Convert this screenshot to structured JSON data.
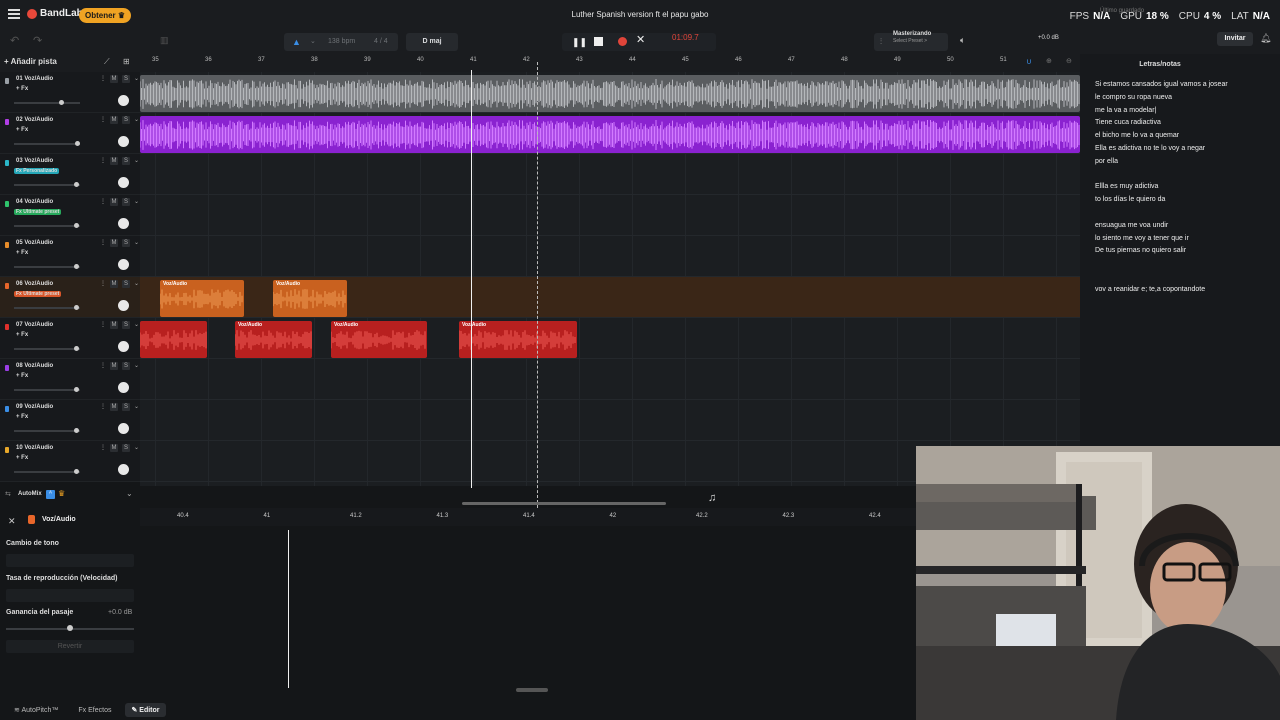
{
  "app": {
    "logo": "BandLab",
    "get_pro": "Obtener ♛",
    "project_title": "Luther Spanish version ft el papu gabo",
    "saved_note": "Último guardado"
  },
  "stats": [
    {
      "label": "FPS",
      "value": "N/A"
    },
    {
      "label": "GPU",
      "value": "18 %"
    },
    {
      "label": "CPU",
      "value": "4 %"
    },
    {
      "label": "LAT",
      "value": "N/A"
    }
  ],
  "transport": {
    "bpm": "138 bpm",
    "signature": "4 / 4",
    "key": "D maj",
    "time": "01:09.7",
    "master_label": "Masterizando",
    "master_sub": "Select Preset >",
    "volume_db": "+0.0 dB",
    "volume_level": 0.76,
    "invite": "Invitar"
  },
  "tracks_header": {
    "add_track": "+ Añadir pista"
  },
  "tracks": [
    {
      "name": "01 Voz/Audio",
      "fx": "+ Fx",
      "color": "#9aa0a6",
      "fx_color": "",
      "vol": 0.72
    },
    {
      "name": "02 Voz/Audio",
      "fx": "+ Fx",
      "color": "#b13ee6",
      "fx_color": "",
      "vol": 0.98
    },
    {
      "name": "03 Voz/Audio",
      "fx": "Fx Personalizado",
      "color": "#2bb7c9",
      "fx_color": "#25a7b8",
      "vol": 0.96
    },
    {
      "name": "04 Voz/Audio",
      "fx": "Fx Ultimate preset",
      "color": "#2fc46c",
      "fx_color": "#27a95c",
      "vol": 0.96
    },
    {
      "name": "05 Voz/Audio",
      "fx": "+ Fx",
      "color": "#e88d2a",
      "fx_color": "",
      "vol": 0.96
    },
    {
      "name": "06 Voz/Audio",
      "fx": "Fx Ultimate preset",
      "color": "#e8662a",
      "fx_color": "#d8562a",
      "vol": 0.96
    },
    {
      "name": "07 Voz/Audio",
      "fx": "+ Fx",
      "color": "#e0302c",
      "fx_color": "",
      "vol": 0.96
    },
    {
      "name": "08 Voz/Audio",
      "fx": "+ Fx",
      "color": "#9b3ee6",
      "fx_color": "",
      "vol": 0.96
    },
    {
      "name": "09 Voz/Audio",
      "fx": "+ Fx",
      "color": "#3a8ee6",
      "fx_color": "",
      "vol": 0.96
    },
    {
      "name": "10 Voz/Audio",
      "fx": "+ Fx",
      "color": "#e8a82a",
      "fx_color": "",
      "vol": 0.96
    }
  ],
  "automix": {
    "label": "AutoMix"
  },
  "ruler_bars": [
    "35",
    "36",
    "37",
    "38",
    "39",
    "40",
    "41",
    "42",
    "43",
    "44",
    "45",
    "46",
    "47",
    "48",
    "49",
    "50",
    "51"
  ],
  "clip_label": "Voz/Audio",
  "lyrics": {
    "title": "Letras/notas",
    "lines": [
      "Si estamos cansados igual vamos a josear",
      "le compro su ropa nueva",
      "me la va a modelar|",
      "Tiene cuca radiactiva",
      "el bicho me lo va a quemar",
      "Ella es adictiva no te lo voy a negar",
      "por ella",
      "",
      "Ellla es muy adictiva",
      "to los días le quiero da",
      "",
      "ensuagua me voa undir",
      "lo siento me voy a tener que ir",
      "De tus piernas no quiero salir",
      "",
      "",
      "vov a reanidar e; te,a copontandote"
    ]
  },
  "editor": {
    "track_name": "Voz/Audio",
    "ticks": [
      "40.4",
      "41",
      "41.2",
      "41.3",
      "41.4",
      "42",
      "42.2",
      "42.3",
      "42.4"
    ],
    "pitch_label": "Cambio de tono",
    "rate_label": "Tasa de reproducción (Velocidad)",
    "gain_label": "Ganancia del pasaje",
    "gain_value": "+0.0 dB",
    "revert": "Revertir"
  },
  "bottom_tabs": [
    "AutoPitch™",
    "Fx  Efectos",
    "Editor"
  ]
}
